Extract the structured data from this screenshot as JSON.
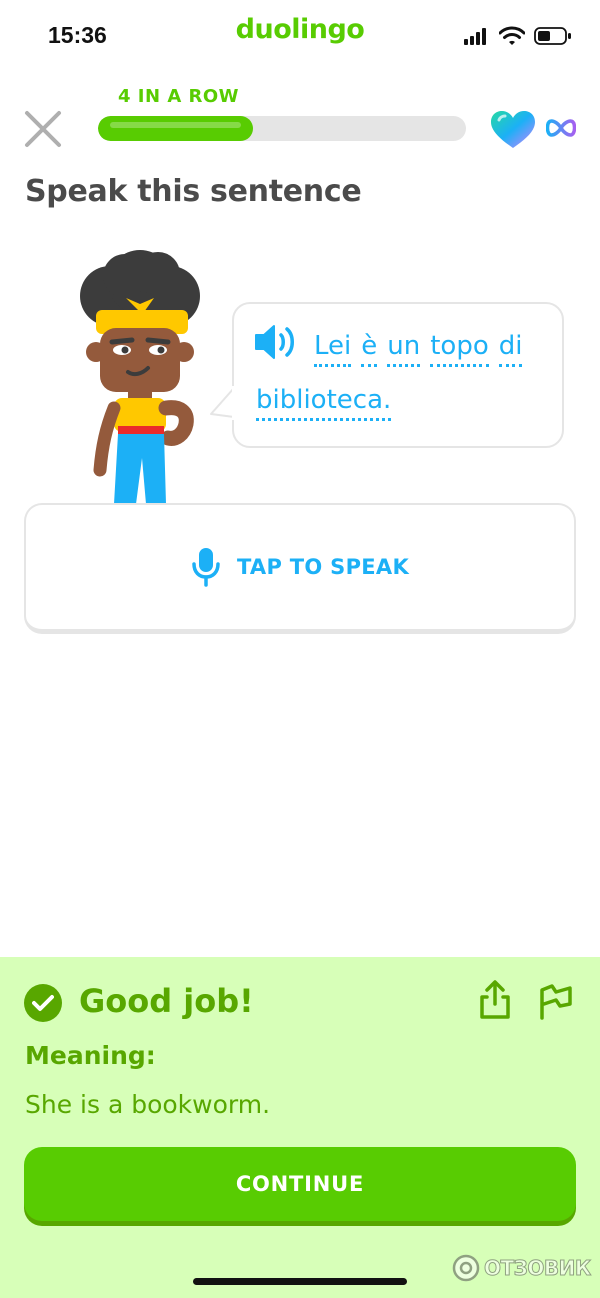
{
  "status_bar": {
    "time": "15:36",
    "icons": [
      "signal-icon",
      "wifi-icon",
      "battery-icon"
    ]
  },
  "app": {
    "logo_text": "duolingo"
  },
  "header": {
    "streak_label": "4 IN A ROW",
    "progress_fraction": 0.42,
    "hearts": "∞",
    "icons": [
      "close-icon",
      "heart-icon",
      "infinity-icon"
    ]
  },
  "exercise": {
    "title": "Speak this sentence",
    "line1_words": [
      "Lei",
      "è",
      "un",
      "topo",
      "di"
    ],
    "line2_words": [
      "biblioteca."
    ],
    "speak_button_label": "TAP TO SPEAK",
    "icons": [
      "speaker-icon",
      "microphone-icon"
    ]
  },
  "feedback": {
    "title": "Good job!",
    "meaning_label": "Meaning:",
    "meaning_text": "She is a bookworm.",
    "continue_label": "CONTINUE",
    "icons": [
      "check-icon",
      "share-icon",
      "flag-icon"
    ]
  },
  "watermark": {
    "text": "ОТЗОВИК"
  },
  "colors": {
    "brand_green": "#58cc02",
    "dark_green": "#58a700",
    "feedback_bg": "#d7ffb8",
    "link_blue": "#1cb0f6",
    "text_gray": "#4b4b4b",
    "track_gray": "#e5e5e5"
  }
}
